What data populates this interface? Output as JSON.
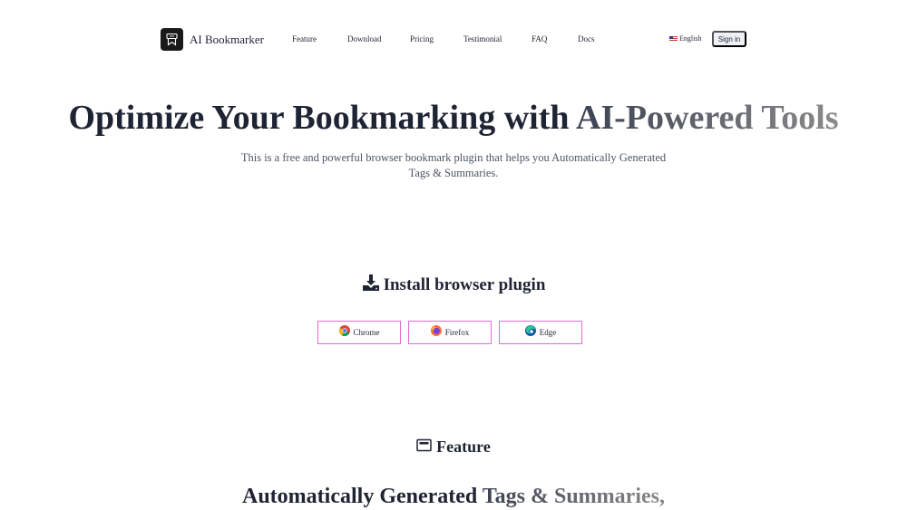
{
  "brand": {
    "name": "AI Bookmarker",
    "logo_icon": "bookmark-logo-icon"
  },
  "nav": {
    "links": [
      {
        "label": "Feature"
      },
      {
        "label": "Download"
      },
      {
        "label": "Pricing"
      },
      {
        "label": "Testimonial"
      },
      {
        "label": "FAQ"
      },
      {
        "label": "Docs"
      }
    ],
    "language": {
      "flag_icon": "us-flag-icon",
      "label": "English"
    },
    "signin_label": "Sign in"
  },
  "hero": {
    "title_main": "Optimize Your Bookmarking with ",
    "title_highlight": "AI-Powered Tools",
    "subtitle": "This is a free and powerful browser bookmark plugin that helps you Automatically Generated Tags & Summaries."
  },
  "install": {
    "heading": "Install browser plugin",
    "icon": "download-icon",
    "browsers": [
      {
        "label": "Chrome",
        "icon": "chrome-icon"
      },
      {
        "label": "Firefox",
        "icon": "firefox-icon"
      },
      {
        "label": "Edge",
        "icon": "edge-icon"
      }
    ]
  },
  "feature": {
    "heading": "Feature",
    "icon": "card-icon",
    "subtitle_main": "Automatically Generated ",
    "subtitle_highlight": "Tags & Summaries,"
  },
  "colors": {
    "text": "#1e2433",
    "button_border": "#e06bd6",
    "signin_bg": "#eef1f6"
  }
}
